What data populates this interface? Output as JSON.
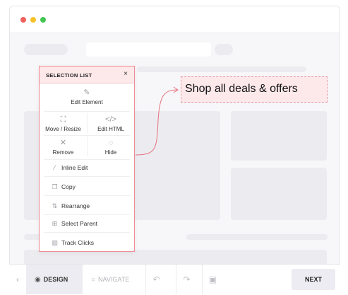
{
  "panel": {
    "title": "SELECTION LIST",
    "close": "×",
    "edit_element": "Edit Element",
    "move_resize": "Move / Resize",
    "edit_html": "Edit HTML",
    "remove": "Remove",
    "hide": "Hide",
    "inline_edit": "Inline Edit",
    "copy": "Copy",
    "rearrange": "Rearrange",
    "select_parent": "Select Parent",
    "track_clicks": "Track Clicks"
  },
  "callout": {
    "text": "Shop all deals & offers"
  },
  "toolbar": {
    "back": "‹",
    "design": "DESIGN",
    "navigate": "NAVIGATE",
    "next": "NEXT"
  },
  "icons": {
    "edit_element": "pencil-square-icon",
    "move_resize": "move-resize-icon",
    "edit_html": "code-icon",
    "remove": "x-icon",
    "hide": "eye-off-icon",
    "inline_edit": "pen-icon",
    "copy": "copy-icon",
    "rearrange": "rearrange-icon",
    "select_parent": "hierarchy-icon",
    "track_clicks": "trash-icon"
  },
  "colors": {
    "panel_border": "#ef8c95",
    "panel_header": "#fde8ea",
    "connector": "#e5707c"
  }
}
